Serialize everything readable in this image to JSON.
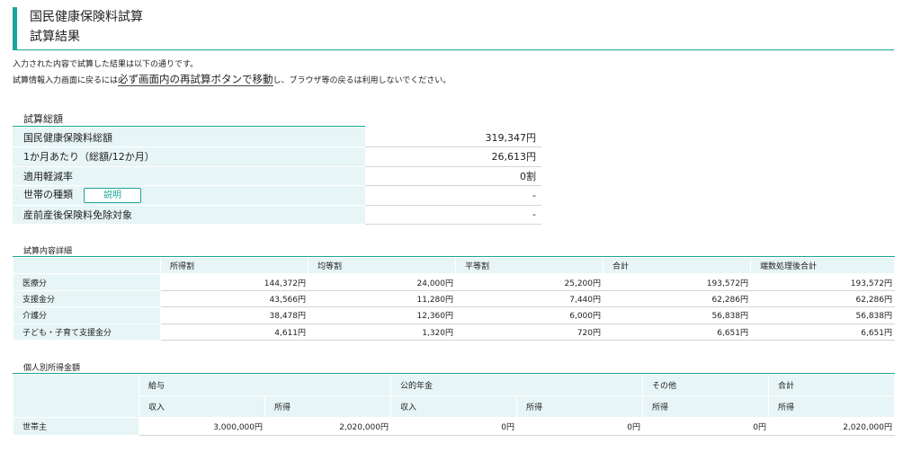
{
  "header": {
    "title": "国民健康保険料試算",
    "subtitle": "試算結果"
  },
  "intro": {
    "line1": "入力された内容で試算した結果は以下の通りです。",
    "line2_pre": "試算情報入力画面に戻るには",
    "line2_emph": "必ず画面内の再試算ボタンで移動",
    "line2_post": "し、ブラウザ等の戻るは利用しないでください。"
  },
  "summary": {
    "title": "試算総額",
    "rows": [
      {
        "label": "国民健康保険料総額",
        "value": "319,347円"
      },
      {
        "label": "1か月あたり（総額/12か月）",
        "value": "26,613円"
      },
      {
        "label": "適用軽減率",
        "value": "0割"
      },
      {
        "label": "世帯の種類",
        "value": "-",
        "button": "説明"
      },
      {
        "label": "産前産後保険料免除対象",
        "value": "-"
      }
    ]
  },
  "detail": {
    "title": "試算内容詳細",
    "headers": [
      "",
      "所得割",
      "均等割",
      "平等割",
      "合計",
      "端数処理後合計"
    ],
    "rows": [
      {
        "label": "医療分",
        "cells": [
          "144,372円",
          "24,000円",
          "25,200円",
          "193,572円",
          "193,572円"
        ]
      },
      {
        "label": "支援金分",
        "cells": [
          "43,566円",
          "11,280円",
          "7,440円",
          "62,286円",
          "62,286円"
        ]
      },
      {
        "label": "介護分",
        "cells": [
          "38,478円",
          "12,360円",
          "6,000円",
          "56,838円",
          "56,838円"
        ]
      },
      {
        "label": "子ども・子育て支援金分",
        "cells": [
          "4,611円",
          "1,320円",
          "720円",
          "6,651円",
          "6,651円"
        ]
      }
    ]
  },
  "person": {
    "title": "個人別所得金額",
    "groups": [
      "給与",
      "公的年金",
      "その他",
      "合計"
    ],
    "subheaders": [
      "収入",
      "所得",
      "収入",
      "所得",
      "所得",
      "所得"
    ],
    "rows": [
      {
        "label": "世帯主",
        "cells": [
          "3,000,000円",
          "2,020,000円",
          "0円",
          "0円",
          "0円",
          "2,020,000円"
        ]
      }
    ]
  }
}
